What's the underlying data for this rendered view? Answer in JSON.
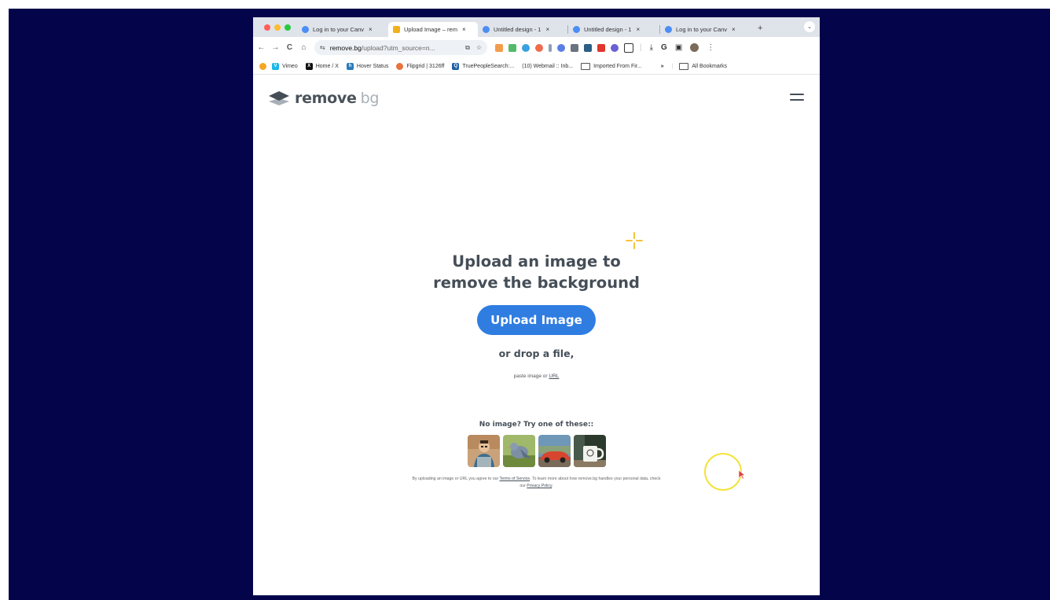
{
  "browser": {
    "tabs": [
      {
        "title": "Log in to your Canv",
        "active": false,
        "favicon_color": "#4b8ef5"
      },
      {
        "title": "Upload Image – rem",
        "active": true,
        "favicon_color": "#f2b01e"
      },
      {
        "title": "Untitled design - 1",
        "active": false,
        "favicon_color": "#4b8ef5"
      },
      {
        "title": "Untitled design - 1",
        "active": false,
        "favicon_color": "#4b8ef5"
      },
      {
        "title": "Log in to your Canv",
        "active": false,
        "favicon_color": "#4b8ef5"
      }
    ],
    "new_tab": "+",
    "tab_close": "×",
    "tab_menu": "⌄",
    "nav": {
      "back": "←",
      "forward": "→",
      "reload": "C",
      "home": "⌂"
    },
    "address": {
      "host": "remove.bg",
      "path": "/upload?utm_source=n..."
    },
    "right_controls": {
      "download": "⤓",
      "grammarly": "G",
      "sidepanel": "▣",
      "menu": "⋮"
    },
    "bookmarks": [
      {
        "label": "Vimeo",
        "color": "#1ab7ea",
        "glyph": "V"
      },
      {
        "label": "Home / X",
        "color": "#111111",
        "glyph": "X"
      },
      {
        "label": "Hover Status",
        "color": "#2b7bb9",
        "glyph": "h"
      },
      {
        "label": "Flipgrid | 3126ff",
        "color": "#e8743b",
        "glyph": "F"
      },
      {
        "label": "TruePeopleSearch:...",
        "color": "#1f5fa8",
        "glyph": "Q"
      },
      {
        "label": "(10) Webmail :: Inb...",
        "color": "",
        "glyph": ""
      },
      {
        "label": "Imported From Fir...",
        "color": "",
        "glyph": ""
      }
    ],
    "bookmarks_overflow": "»",
    "all_bookmarks": "All Bookmarks"
  },
  "site": {
    "logo_word": "remove",
    "logo_suffix": "bg",
    "headline_line1": "Upload an image to",
    "headline_line2": "remove the background",
    "upload_button": "Upload Image",
    "drop_text": "or drop a file,",
    "paste_prefix": "paste image or ",
    "paste_link": "URL",
    "samples_heading": "No image? Try one of these::",
    "samples": [
      "person",
      "bird",
      "car",
      "mug"
    ],
    "legal_part1": "By uploading an image or URL you agree to our ",
    "legal_terms": "Terms of Service",
    "legal_part2": ". To learn more about how remove.bg handles your personal data, check our ",
    "legal_privacy": "Privacy Policy",
    "legal_end": "."
  },
  "colors": {
    "backdrop": "#03044a",
    "primary": "#2f7de1",
    "heading": "#454e57",
    "accent_sparkle": "#f5c33b",
    "cursor_ring": "#f3e33b"
  }
}
